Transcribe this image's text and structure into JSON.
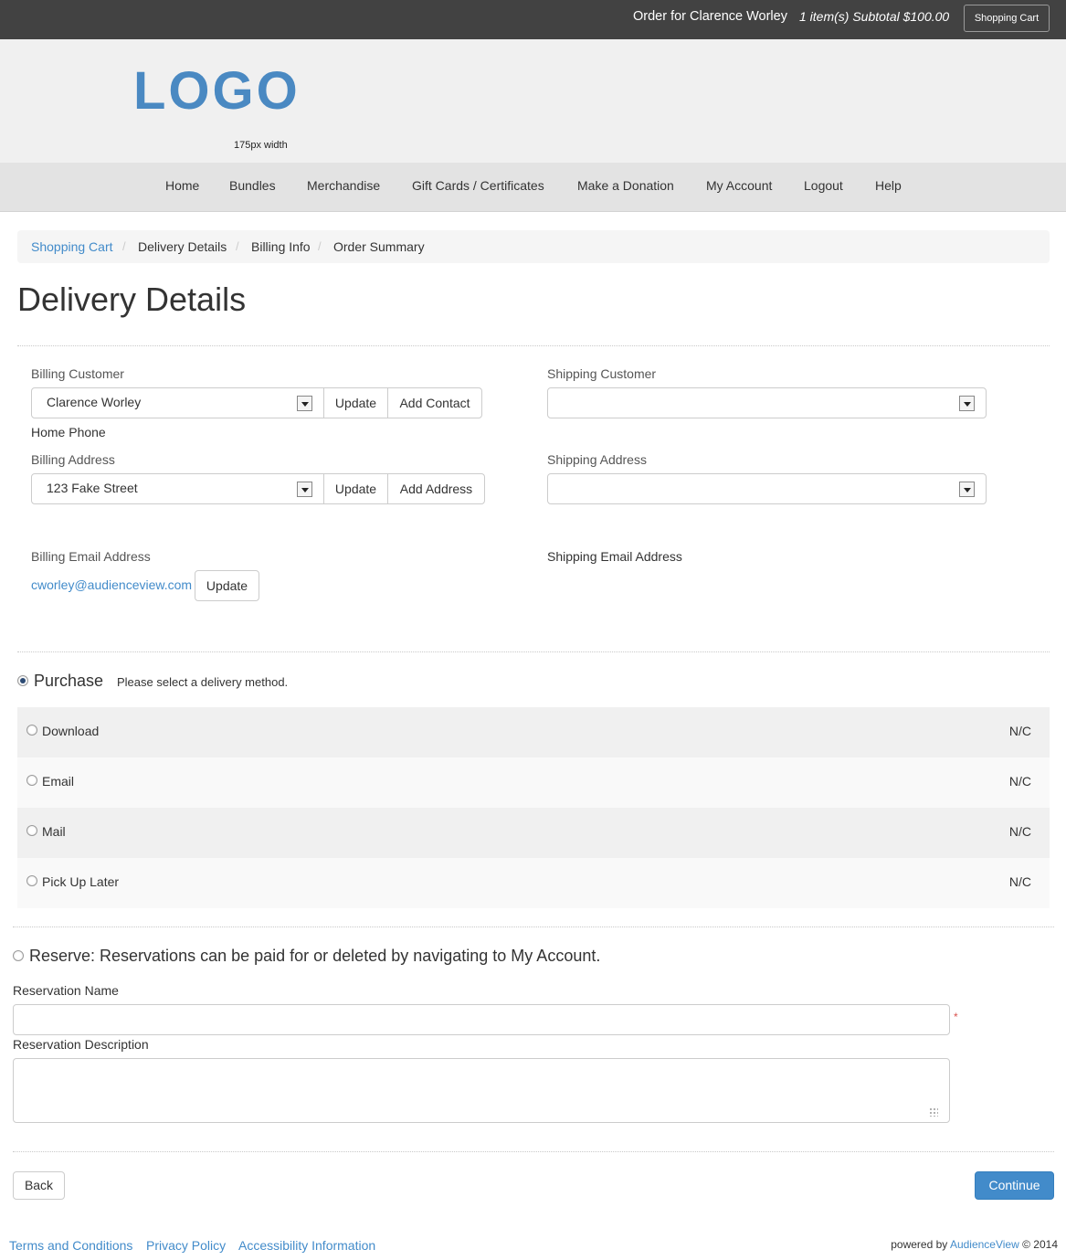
{
  "topbar": {
    "order_for": "Order for Clarence Worley",
    "subtotal": "1 item(s) Subtotal $100.00",
    "cart_button": "Shopping Cart"
  },
  "header": {
    "logo": "LOGO",
    "logo_caption": "175px width"
  },
  "nav": {
    "items": [
      "Home",
      "Bundles",
      "Merchandise",
      "Gift Cards / Certificates",
      "Make a Donation",
      "My Account",
      "Logout",
      "Help"
    ]
  },
  "breadcrumb": {
    "items": [
      "Shopping Cart",
      "Delivery Details",
      "Billing Info",
      "Order Summary"
    ],
    "separator": "/"
  },
  "page_title": "Delivery Details",
  "billing": {
    "customer_label": "Billing Customer",
    "customer_value": "Clarence Worley",
    "update_label": "Update",
    "add_contact_label": "Add Contact",
    "home_phone_label": "Home Phone",
    "address_label": "Billing Address",
    "address_value": "123 Fake Street",
    "add_address_label": "Add Address",
    "email_label": "Billing Email Address",
    "email_value": "cworley@audienceview.com"
  },
  "shipping": {
    "customer_label": "Shipping Customer",
    "customer_value": "",
    "address_label": "Shipping Address",
    "address_value": "",
    "email_label": "Shipping Email Address"
  },
  "purchase": {
    "title": "Purchase",
    "note": "Please select a delivery method.",
    "selected": true,
    "methods": [
      {
        "label": "Download",
        "price": "N/C"
      },
      {
        "label": "Email",
        "price": "N/C"
      },
      {
        "label": "Mail",
        "price": "N/C"
      },
      {
        "label": "Pick Up Later",
        "price": "N/C"
      }
    ]
  },
  "reserve": {
    "title": "Reserve: Reservations can be paid for or deleted by navigating to My Account.",
    "name_label": "Reservation Name",
    "required_mark": "*",
    "description_label": "Reservation Description",
    "name_value": "",
    "description_value": ""
  },
  "actions": {
    "back": "Back",
    "continue": "Continue"
  },
  "footer": {
    "links": [
      "Terms and Conditions",
      "Privacy Policy",
      "Accessibility Information"
    ],
    "powered_prefix": "powered by",
    "powered_brand": "AudienceView",
    "powered_suffix": "© 2014"
  },
  "colors": {
    "topbar_bg": "#424242",
    "header_bg": "#f0f0f0",
    "nav_bg": "#e3e3e3",
    "link": "#428bca",
    "logo": "#4a89c2",
    "primary_button": "#428bca",
    "required": "#d9534f"
  }
}
